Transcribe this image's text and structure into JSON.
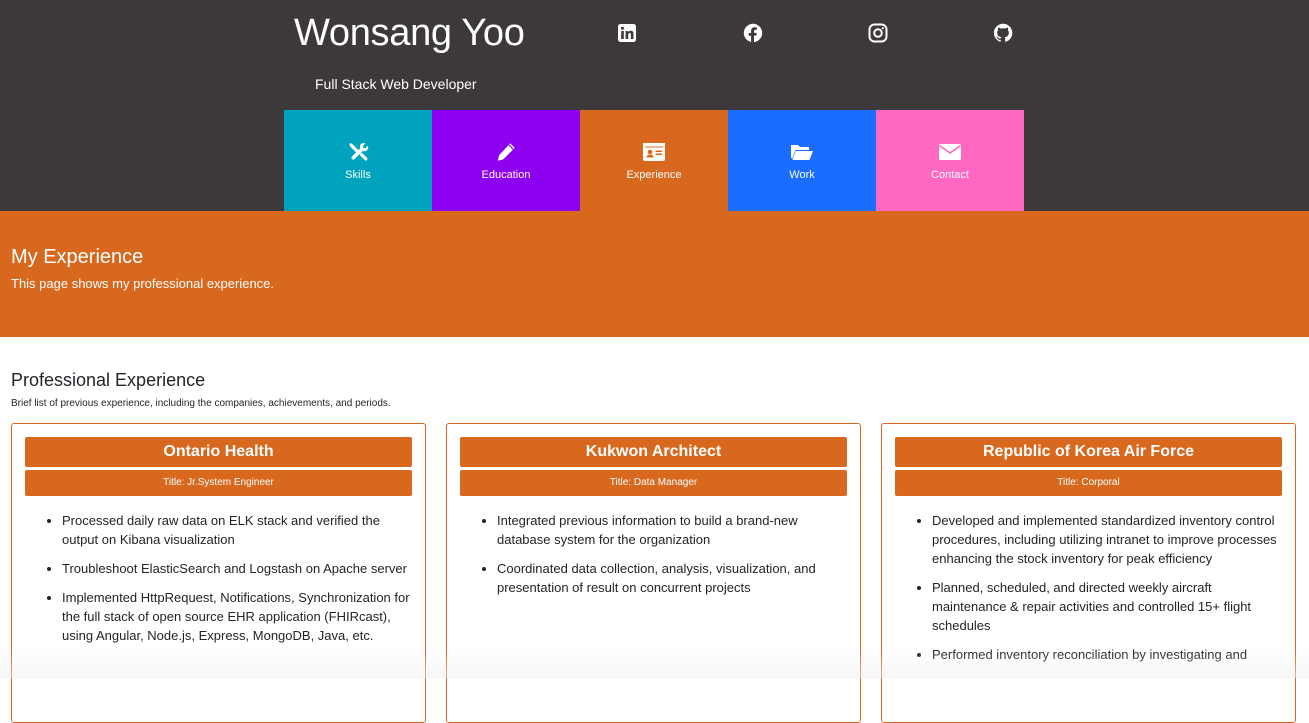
{
  "header": {
    "name": "Wonsang Yoo",
    "subtitle": "Full Stack Web Developer",
    "background": "#3d393a",
    "social": [
      {
        "icon": "linkedin-icon"
      },
      {
        "icon": "facebook-icon"
      },
      {
        "icon": "instagram-icon"
      },
      {
        "icon": "github-icon"
      }
    ]
  },
  "nav": [
    {
      "label": "Skills",
      "icon": "tools-icon",
      "color": "#00a3bd"
    },
    {
      "label": "Education",
      "icon": "pencil-icon",
      "color": "#8c00ef"
    },
    {
      "label": "Experience",
      "icon": "id-card-icon",
      "color": "#d9681f"
    },
    {
      "label": "Work",
      "icon": "folder-open-icon",
      "color": "#1a6dff"
    },
    {
      "label": "Contact",
      "icon": "envelope-icon",
      "color": "#ff67c0"
    }
  ],
  "banner": {
    "title": "My Experience",
    "description": "This page shows my professional experience.",
    "color": "#d9681f"
  },
  "section": {
    "title": "Professional Experience",
    "subtitle": "Brief list of previous experience, including the companies, achievements, and periods."
  },
  "experience": [
    {
      "company": "Ontario Health",
      "title": "Title: Jr.System Engineer",
      "items": [
        "Processed daily raw data on ELK stack and verified the output on Kibana visualization",
        "Troubleshoot ElasticSearch and Logstash on Apache server",
        "Implemented HttpRequest, Notifications, Synchronization for the full stack of open source EHR application (FHIRcast), using Angular, Node.js, Express, MongoDB, Java, etc."
      ]
    },
    {
      "company": "Kukwon Architect",
      "title": "Title: Data Manager",
      "items": [
        "Integrated previous information to build a brand-new database system for the organization",
        "Coordinated data collection, analysis, visualization, and presentation of result on concurrent projects"
      ]
    },
    {
      "company": "Republic of Korea Air Force",
      "title": "Title: Corporal",
      "items": [
        "Developed and implemented standardized inventory control procedures, including utilizing intranet to improve processes enhancing the stock inventory for peak efficiency",
        "Planned, scheduled, and directed weekly aircraft maintenance & repair activities and controlled 15+ flight schedules",
        "Performed inventory reconciliation by investigating and"
      ]
    }
  ]
}
